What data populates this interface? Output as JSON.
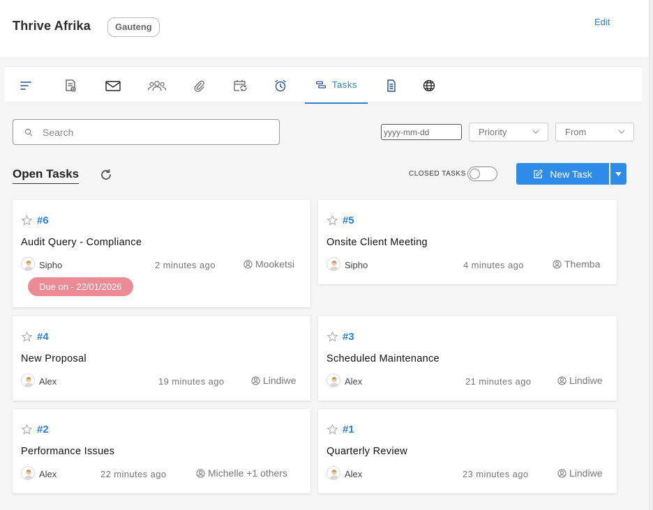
{
  "header": {
    "title": "Thrive Afrika",
    "badge": "Gauteng",
    "edit_label": "Edit"
  },
  "tabs": [
    {
      "icon": "sort-lines-icon"
    },
    {
      "icon": "note-add-icon"
    },
    {
      "icon": "mail-icon"
    },
    {
      "icon": "group-icon"
    },
    {
      "icon": "paperclip-icon"
    },
    {
      "icon": "calendar-repeat-icon"
    },
    {
      "icon": "alarm-clock-icon"
    },
    {
      "icon": "tasks-icon",
      "label": "Tasks",
      "active": true
    },
    {
      "icon": "document-icon"
    },
    {
      "icon": "globe-icon"
    }
  ],
  "filters": {
    "search_placeholder": "Search",
    "date_placeholder": "yyyy-mm-dd",
    "priority_label": "Priority",
    "from_label": "From"
  },
  "toolbar": {
    "section_title": "Open Tasks",
    "closed_tasks_label": "CLOSED TASKS",
    "closed_tasks_on": false,
    "new_task_label": "New Task"
  },
  "tasks": [
    {
      "number": "#6",
      "title": "Audit Query - Compliance",
      "user": "Sipho",
      "time": "2 minutes ago",
      "assignee": "Mooketsi",
      "due": "Due on - 22/01/2026"
    },
    {
      "number": "#5",
      "title": "Onsite Client Meeting",
      "user": "Sipho",
      "time": "4 minutes ago",
      "assignee": "Themba"
    },
    {
      "number": "#4",
      "title": "New Proposal",
      "user": "Alex",
      "time": "19 minutes ago",
      "assignee": "Lindiwe"
    },
    {
      "number": "#3",
      "title": "Scheduled Maintenance",
      "user": "Alex",
      "time": "21 minutes ago",
      "assignee": "Lindiwe"
    },
    {
      "number": "#2",
      "title": "Performance Issues",
      "user": "Alex",
      "time": "22 minutes ago",
      "assignee": "Michelle +1 others"
    },
    {
      "number": "#1",
      "title": "Quarterly Review",
      "user": "Alex",
      "time": "23 minutes ago",
      "assignee": "Lindiwe"
    }
  ],
  "colors": {
    "accent": "#2e8ce8",
    "link": "#2a7fd4",
    "due_badge": "#ea8b96"
  }
}
